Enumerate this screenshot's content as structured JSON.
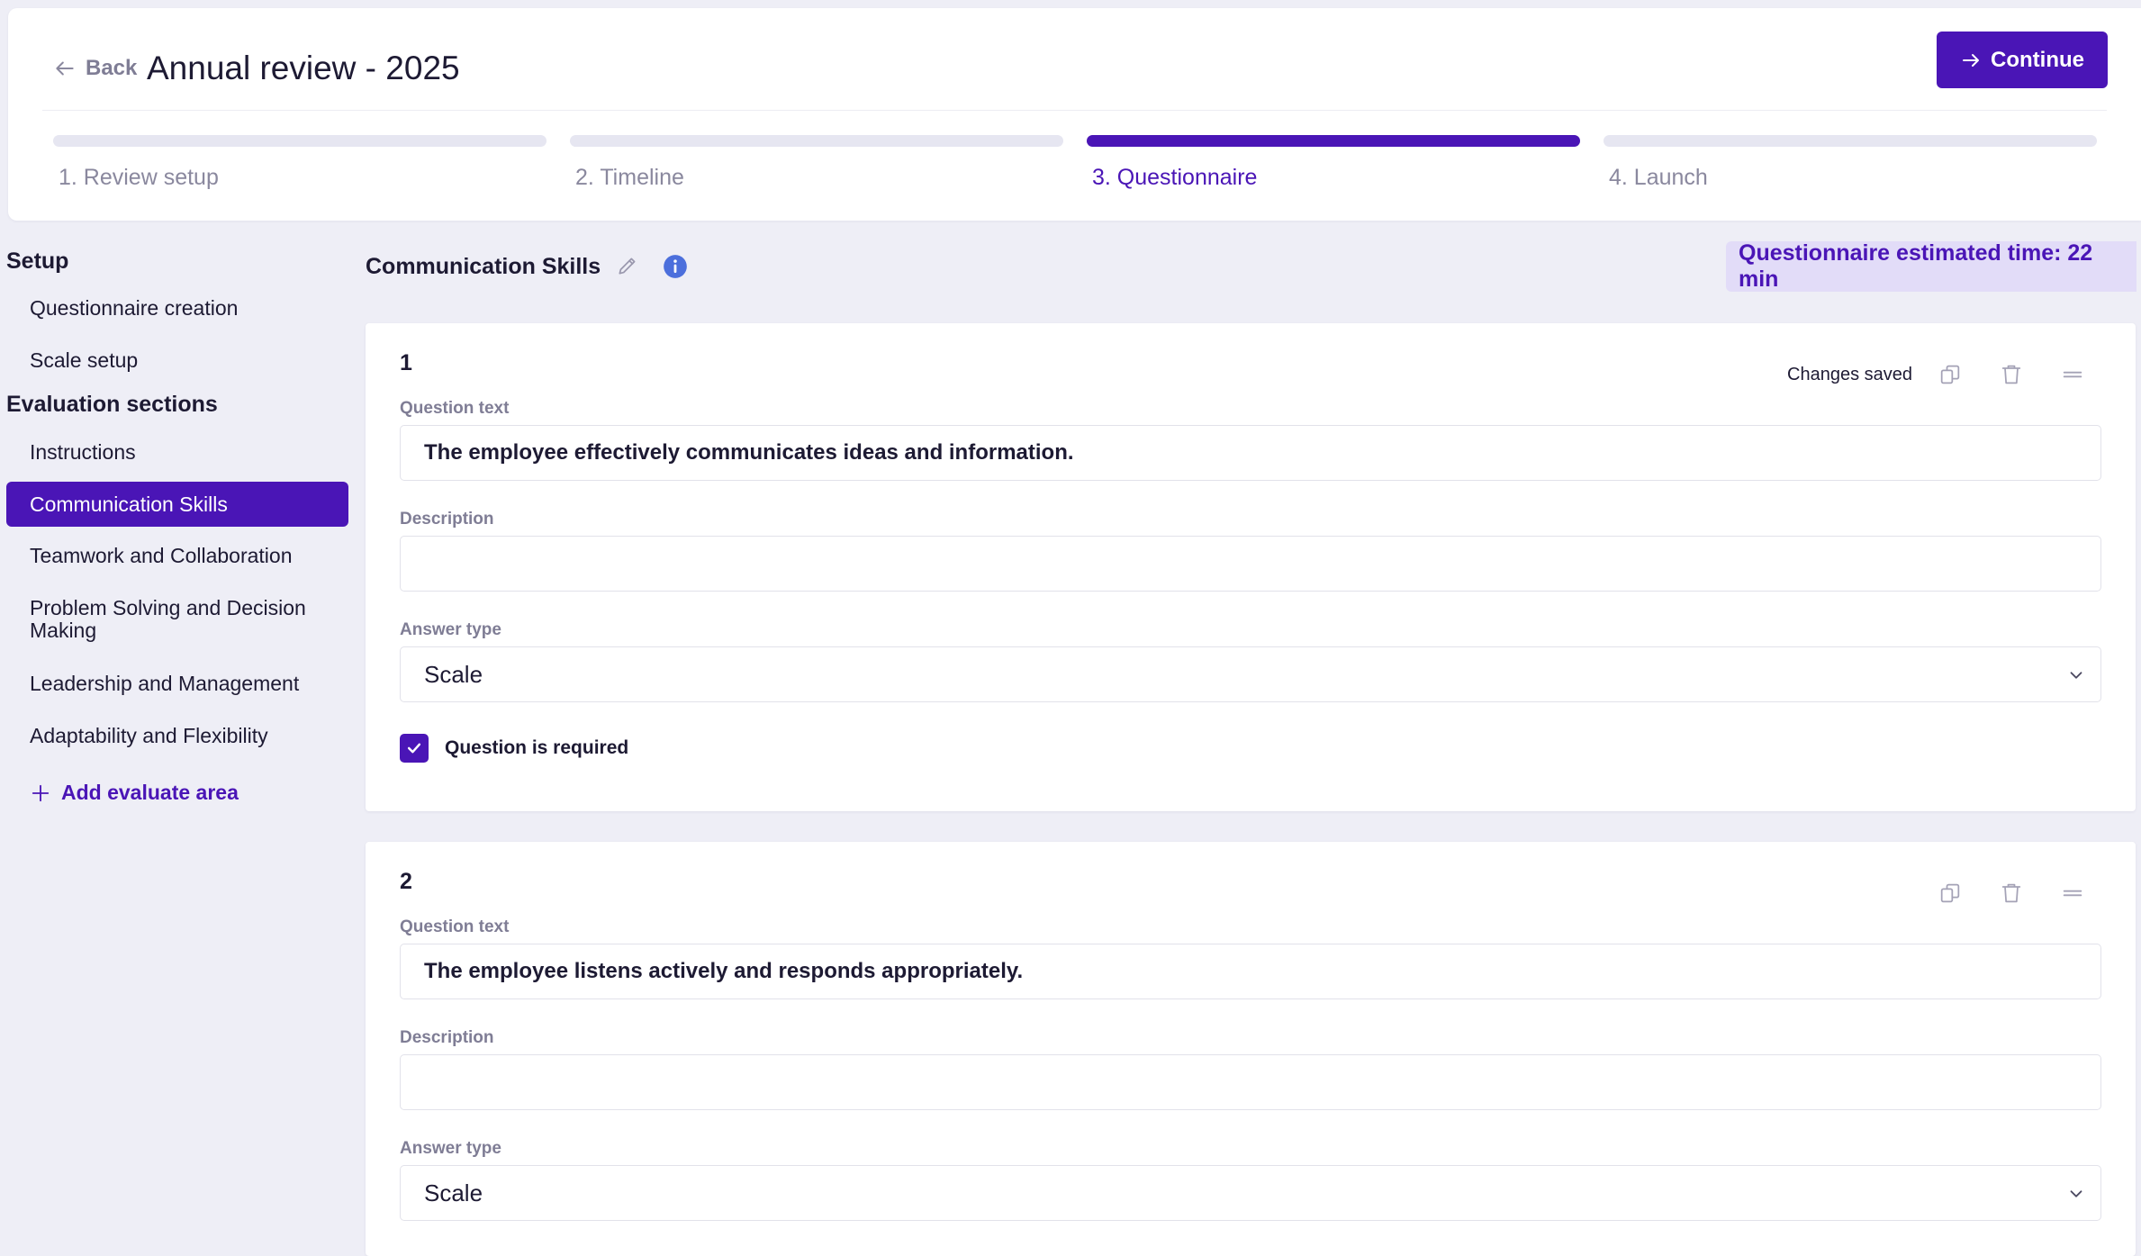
{
  "header": {
    "back_label": "Back",
    "title": "Annual review - 2025",
    "continue_label": "Continue"
  },
  "steps": [
    {
      "label": "1. Review setup",
      "active": false
    },
    {
      "label": "2. Timeline",
      "active": false
    },
    {
      "label": "3. Questionnaire",
      "active": true
    },
    {
      "label": "4. Launch",
      "active": false
    }
  ],
  "sidebar": {
    "setup_heading": "Setup",
    "setup_items": [
      "Questionnaire creation",
      "Scale setup"
    ],
    "sections_heading": "Evaluation sections",
    "section_items": [
      "Instructions",
      "Communication Skills",
      "Teamwork and Collaboration",
      "Problem Solving and Decision Making",
      "Leadership and Management",
      "Adaptability and Flexibility"
    ],
    "active_item": "Communication Skills",
    "add_label": "Add evaluate area"
  },
  "section": {
    "title": "Communication Skills",
    "estimated_time": "Questionnaire estimated time: 22 min"
  },
  "questions": [
    {
      "number": "1",
      "status": "Changes saved",
      "question_label": "Question text",
      "question_text": "The employee effectively communicates ideas and information.",
      "description_label": "Description",
      "description": "",
      "answer_type_label": "Answer type",
      "answer_type": "Scale",
      "required_label": "Question is required",
      "required": true
    },
    {
      "number": "2",
      "status": "",
      "question_label": "Question text",
      "question_text": "The employee listens actively and responds appropriately.",
      "description_label": "Description",
      "description": "",
      "answer_type_label": "Answer type",
      "answer_type": "Scale"
    }
  ],
  "icons": {
    "back": "arrow-left-icon",
    "continue": "arrow-right-icon",
    "edit": "pencil-icon",
    "info": "info-icon",
    "copy": "copy-icon",
    "delete": "trash-icon",
    "drag": "drag-handle-icon",
    "dropdown": "chevron-down-icon",
    "check": "check-icon",
    "add": "plus-icon"
  },
  "colors": {
    "accent": "#4a15b6",
    "page_background": "#eeeef6",
    "estimated_time_background": "#e2dcf8",
    "muted_text": "#7f7d95"
  }
}
